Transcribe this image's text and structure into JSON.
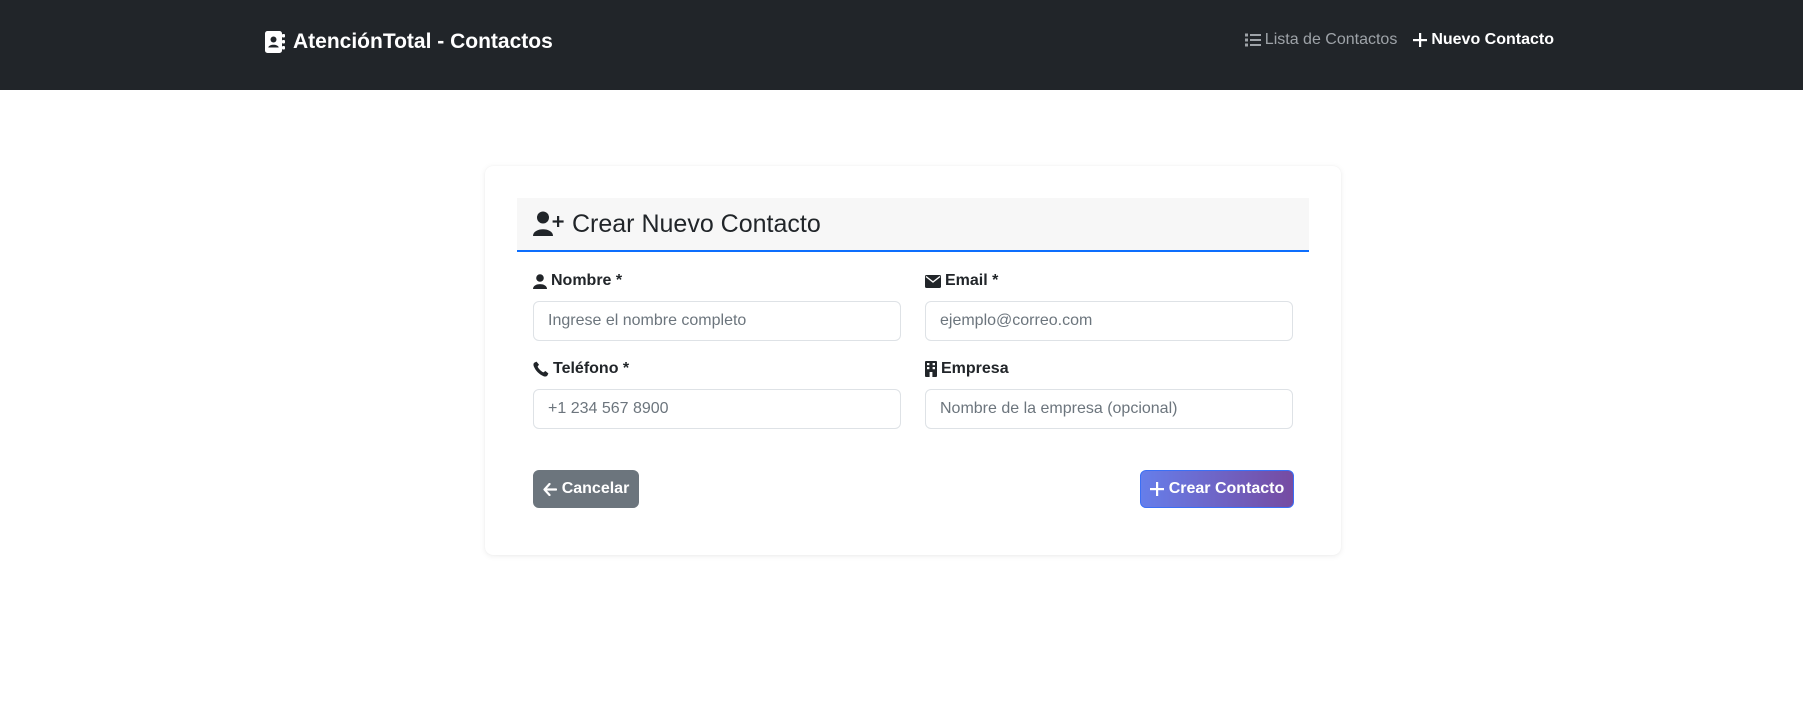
{
  "navbar": {
    "brand": "AtenciónTotal - Contactos",
    "brand_icon": "address-book-icon",
    "links": [
      {
        "label": "Lista de Contactos",
        "icon": "list-icon",
        "active": false
      },
      {
        "label": "Nuevo Contacto",
        "icon": "plus-icon",
        "active": true
      }
    ]
  },
  "form": {
    "title": "Crear Nuevo Contacto",
    "title_icon": "user-plus-icon",
    "fields": {
      "nombre": {
        "label": "Nombre *",
        "icon": "user-icon",
        "value": "",
        "placeholder": "Ingrese el nombre completo"
      },
      "email": {
        "label": "Email *",
        "icon": "envelope-icon",
        "value": "",
        "placeholder": "ejemplo@correo.com"
      },
      "telefono": {
        "label": "Teléfono *",
        "icon": "phone-icon",
        "value": "",
        "placeholder": "+1 234 567 8900"
      },
      "empresa": {
        "label": "Empresa",
        "icon": "building-icon",
        "value": "",
        "placeholder": "Nombre de la empresa (opcional)"
      }
    },
    "cancel_label": "Cancelar",
    "submit_label": "Crear Contacto"
  },
  "colors": {
    "navbar_bg": "#212529",
    "accent": "#0d6efd",
    "cancel_bg": "#6c757d",
    "submit_gradient_start": "#667eea",
    "submit_gradient_end": "#764ba2"
  }
}
